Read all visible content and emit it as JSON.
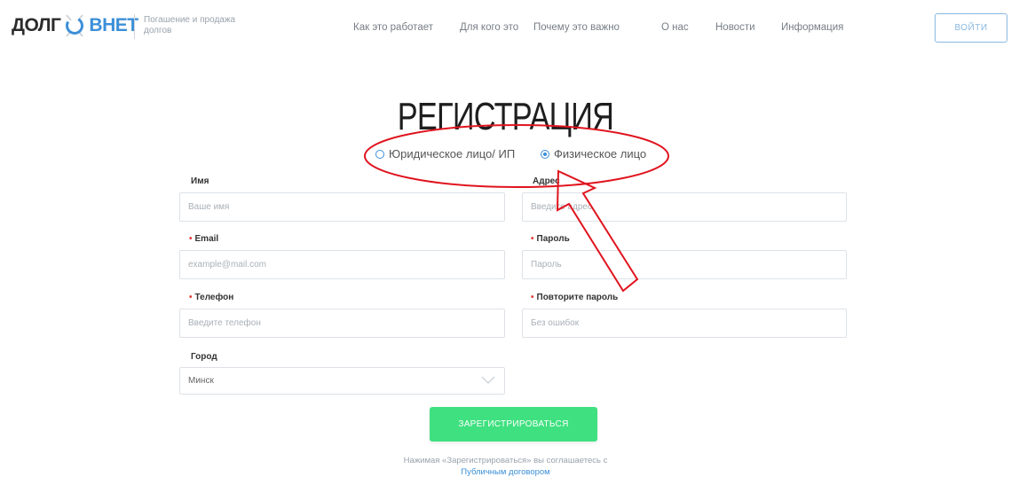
{
  "header": {
    "logo_part1": "ДОЛГ",
    "logo_part2": "ВНЕТ",
    "tagline": "Погашение и продажа долгов",
    "nav": [
      {
        "label": "Как это работает"
      },
      {
        "label": "Для кого это"
      },
      {
        "label": "Почему это важно"
      },
      {
        "label": "О нас"
      },
      {
        "label": "Новости"
      },
      {
        "label": "Информация"
      }
    ],
    "login_label": "ВОЙТИ"
  },
  "form": {
    "title": "РЕГИСТРАЦИЯ",
    "entity_options": [
      {
        "label": "Юридическое лицо/ ИП",
        "checked": false
      },
      {
        "label": "Физическое лицо",
        "checked": true
      }
    ],
    "name": {
      "label": "Имя",
      "placeholder": "Ваше имя"
    },
    "address": {
      "label": "Адрес",
      "placeholder": "Введите адрес"
    },
    "email": {
      "label": "Email",
      "placeholder": "example@mail.com",
      "required": true
    },
    "password": {
      "label": "Пароль",
      "placeholder": "Пароль",
      "required": true
    },
    "phone": {
      "label": "Телефон",
      "placeholder": "Введите телефон",
      "required": true
    },
    "password_repeat": {
      "label": "Повторите пароль",
      "placeholder": "Без ошибок",
      "required": true
    },
    "city": {
      "label": "Город",
      "value": "Минск"
    },
    "required_mark": "•",
    "submit_label": "ЗАРЕГИСТРИРОВАТЬСЯ",
    "agreement_text": "Нажимая «Зарегистрироваться» вы соглашаетесь с",
    "agreement_link": "Публичным договором"
  },
  "colors": {
    "accent": "#3c8fd8",
    "submit": "#3fe07f",
    "annotation": "#e0141e",
    "required": "#e53935"
  }
}
